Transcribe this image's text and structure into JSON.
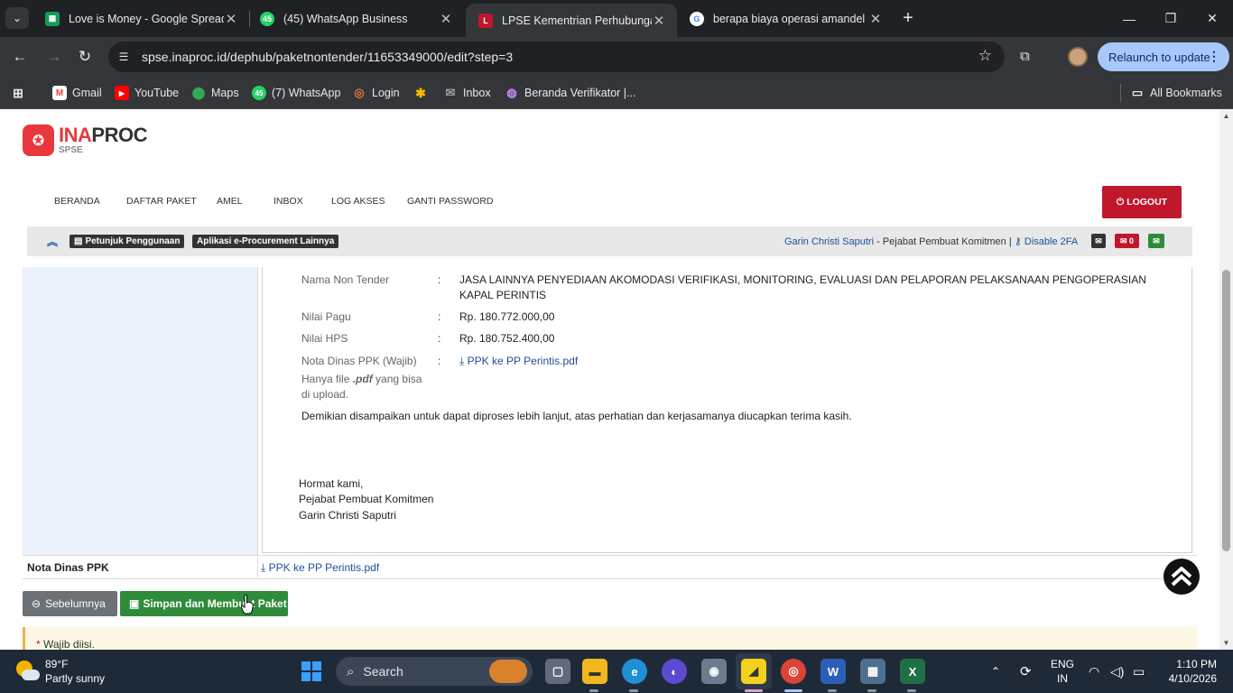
{
  "browser": {
    "tabs": [
      {
        "title": "Love is Money - Google Spread",
        "icon": "sheets-icon",
        "color": "#0f9d58"
      },
      {
        "title": "(45) WhatsApp Business",
        "icon": "whatsapp-icon",
        "color": "#25d366",
        "badge": "45"
      },
      {
        "title": "LPSE Kementrian Perhubungan",
        "icon": "lpse-icon",
        "color": "#c0172d"
      },
      {
        "title": "berapa biaya operasi amandel -",
        "icon": "google-icon",
        "color": "#4285f4"
      }
    ],
    "url": "spse.inaproc.id/dephub/paketnontender/11653349000/edit?step=3",
    "relaunch_label": "Relaunch to update",
    "bookmarks": [
      {
        "label": "Gmail",
        "icon": "gmail-icon"
      },
      {
        "label": "YouTube",
        "icon": "youtube-icon"
      },
      {
        "label": "Maps",
        "icon": "maps-icon"
      },
      {
        "label": "(7) WhatsApp",
        "icon": "whatsapp-icon",
        "badge": "45"
      },
      {
        "label": "Login",
        "icon": "login-icon"
      },
      {
        "label": "",
        "icon": "photos-icon"
      },
      {
        "label": "Inbox",
        "icon": "inbox-icon"
      },
      {
        "label": "Beranda Verifikator |...",
        "icon": "globe-icon"
      }
    ],
    "all_bookmarks": "All Bookmarks"
  },
  "site": {
    "logo": {
      "part1": "INA",
      "part2": "PROC",
      "sub": "SPSE"
    },
    "nav": [
      "BERANDA",
      "DAFTAR PAKET",
      "AMEL",
      "INBOX",
      "LOG AKSES",
      "GANTI PASSWORD"
    ],
    "logout": "LOGOUT",
    "infobar": {
      "guide": "Petunjuk Penggunaan",
      "apps": "Aplikasi e-Procurement Lainnya",
      "user_name": "Garin Christi Saputri",
      "user_role": " - Pejabat Pembuat Komitmen | ",
      "disable_2fa": "Disable 2FA",
      "mail_count": "0"
    },
    "letter": {
      "nama_label": "Nama Non Tender",
      "nama_value_1": "JASA LAINNYA PENYEDIAAN AKOMODASI VERIFIKASI, MONITORING, EVALUASI DAN PELAPORAN PELAKSANAAN PENGOPERASIAN",
      "nama_value_2": "KAPAL PERINTIS",
      "pagu_label": "Nilai Pagu",
      "pagu_value": "Rp. 180.772.000,00",
      "hps_label": "Nilai HPS",
      "hps_value": "Rp. 180.752.400,00",
      "nota_label": "Nota Dinas PPK (Wajib)",
      "nota_hint_1": "Hanya file ",
      "nota_hint_ext": ".pdf",
      "nota_hint_2": " yang bisa",
      "nota_hint_3": "di upload.",
      "nota_file": "PPK ke PP Perintis.pdf",
      "closing": "Demikian disampaikan untuk dapat diproses lebih lanjut, atas perhatian dan kerjasamanya diucapkan terima kasih.",
      "sign_1": "Hormat kami,",
      "sign_2": "Pejabat Pembuat Komitmen",
      "sign_3": "Garin Christi Saputri"
    },
    "nota_row_label": "Nota Dinas PPK",
    "nota_row_file": "PPK ke PP Perintis.pdf",
    "btn_prev": "Sebelumnya",
    "btn_save": "Simpan dan Membuat Paket",
    "required_star": "*",
    "required_note": " Wajib diisi."
  },
  "taskbar": {
    "temp": "89°F",
    "weather": "Partly sunny",
    "search_placeholder": "Search",
    "lang_1": "ENG",
    "lang_2": "IN",
    "time": "1:10 PM",
    "date": "4/10/2026"
  },
  "colors": {
    "brand_red": "#c0172d",
    "link_blue": "#1f4e9a",
    "save_green": "#2e8b3a",
    "chrome_dark": "#202124"
  }
}
